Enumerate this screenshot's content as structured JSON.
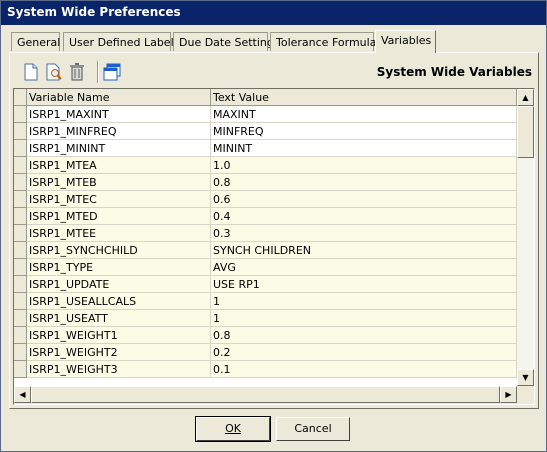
{
  "window": {
    "title": "System Wide Preferences"
  },
  "tabs": [
    {
      "label": "General"
    },
    {
      "label": "User Defined Labels"
    },
    {
      "label": "Due Date Settings"
    },
    {
      "label": "Tolerance Formulas"
    },
    {
      "label": "Variables",
      "active": true
    }
  ],
  "panel": {
    "title": "System Wide Variables"
  },
  "toolbar": {
    "icons": [
      "new-document-icon",
      "search-document-icon",
      "delete-icon",
      "copy-window-icon"
    ]
  },
  "grid": {
    "columns": [
      "Variable Name",
      "Text Value"
    ],
    "rows": [
      {
        "name": "ISRP1_MAXINT",
        "value": "MAXINT"
      },
      {
        "name": "ISRP1_MINFREQ",
        "value": "MINFREQ"
      },
      {
        "name": "ISRP1_MININT",
        "value": "MININT"
      },
      {
        "name": "ISRP1_MTEA",
        "value": "1.0"
      },
      {
        "name": "ISRP1_MTEB",
        "value": "0.8"
      },
      {
        "name": "ISRP1_MTEC",
        "value": "0.6"
      },
      {
        "name": "ISRP1_MTED",
        "value": "0.4"
      },
      {
        "name": "ISRP1_MTEE",
        "value": "0.3"
      },
      {
        "name": "ISRP1_SYNCHCHILD",
        "value": "SYNCH CHILDREN"
      },
      {
        "name": "ISRP1_TYPE",
        "value": "AVG"
      },
      {
        "name": "ISRP1_UPDATE",
        "value": "USE RP1"
      },
      {
        "name": "ISRP1_USEALLCALS",
        "value": "1"
      },
      {
        "name": "ISRP1_USEATT",
        "value": "1"
      },
      {
        "name": "ISRP1_WEIGHT1",
        "value": "0.8"
      },
      {
        "name": "ISRP1_WEIGHT2",
        "value": "0.2"
      },
      {
        "name": "ISRP1_WEIGHT3",
        "value": "0.1"
      }
    ]
  },
  "buttons": {
    "ok": "OK",
    "cancel": "Cancel"
  }
}
